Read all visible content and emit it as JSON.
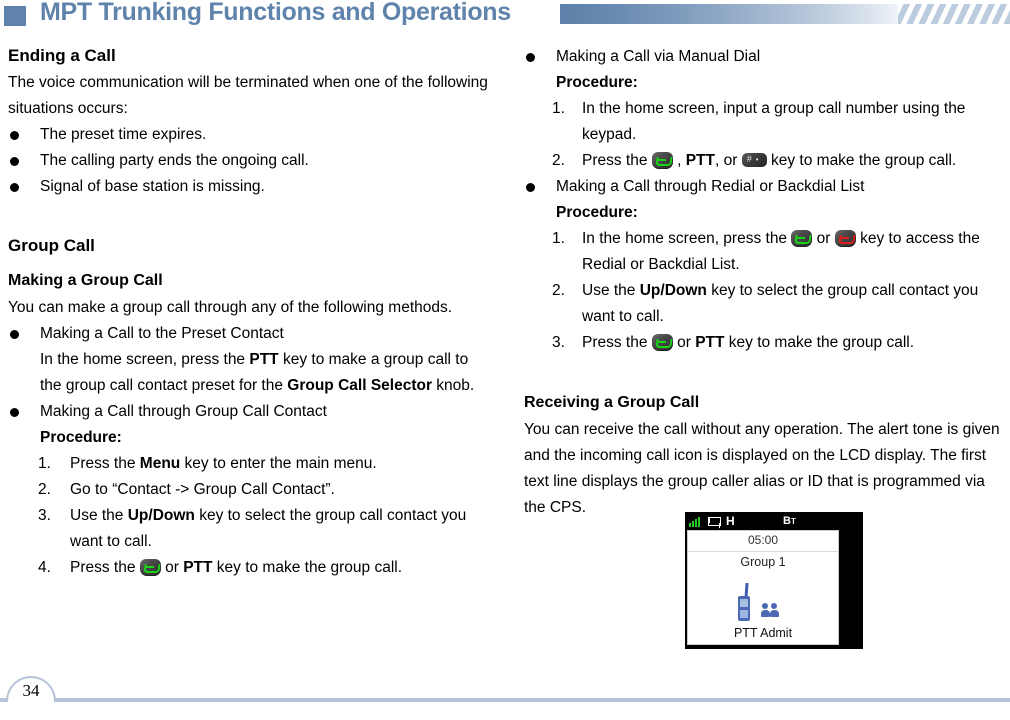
{
  "header": {
    "title": "MPT Trunking Functions and Operations",
    "accent_color": "#5f83ab"
  },
  "left_column": {
    "ending_a_call": {
      "heading": "Ending a Call",
      "intro": "The voice communication will be terminated when one of the following situations occurs:",
      "bullets": [
        "The preset time expires.",
        "The calling party ends the ongoing call.",
        "Signal of base station is missing."
      ]
    },
    "group_call": {
      "heading": "Group Call",
      "making_heading": "Making a Group Call",
      "intro": "You can make a group call through any of the following methods.",
      "preset_contact": {
        "title": "Making a Call to the Preset Contact",
        "body_1": "In the home screen, press the ",
        "body_ptt": "PTT",
        "body_2": " key to make a group call to the group call contact preset for the ",
        "body_bold_2": "Group Call Selector",
        "body_3": " knob."
      },
      "group_call_contact": {
        "title": "Making a Call through Group Call Contact",
        "procedure_label": "Procedure:",
        "steps": [
          {
            "num": "1.",
            "pre": "Press the ",
            "bold": "Menu",
            "post": " key to enter the main menu."
          },
          {
            "num": "2.",
            "pre": "Go to “Contact -> Group Call Contact”.",
            "bold": "",
            "post": ""
          },
          {
            "num": "3.",
            "pre": "Use the ",
            "bold": "Up/Down",
            "post": " key to select the group call contact you want to call."
          },
          {
            "num": "4.",
            "pre": "Press the ",
            "bold": "PTT",
            "post": " key to make the group call."
          }
        ],
        "step4_pre": "Press the ",
        "step4_mid": " or  ",
        "step4_bold": "PTT",
        "step4_post": " key to make the group call."
      }
    }
  },
  "right_column": {
    "manual_dial": {
      "title": "Making a Call via Manual Dial",
      "procedure_label": "Procedure:",
      "step1_num": "1.",
      "step1_text": "In the home screen, input a group call number using the keypad.",
      "step2_num": "2.",
      "step2_pre": "Press the ",
      "step2_mid": " , ",
      "step2_bold": "PTT",
      "step2_mid2": ", or ",
      "step2_post": " key to make the group call."
    },
    "redial": {
      "title": "Making a Call through Redial or Backdial List",
      "procedure_label": "Procedure:",
      "step1_num": "1.",
      "step1_pre": "In the home screen, press the ",
      "step1_mid": " or ",
      "step1_post": " key to access the Redial or Backdial List.",
      "step2_num": "2.",
      "step2_pre": "Use the ",
      "step2_bold": "Up/Down",
      "step2_post": " key to select the group call contact you want to call.",
      "step3_num": "3.",
      "step3_pre": "Press the ",
      "step3_mid": " or ",
      "step3_bold": "PTT",
      "step3_post": " key to make the group call."
    },
    "receiving": {
      "heading": "Receiving a Group Call",
      "body": "You can receive the call without any operation. The alert tone is given and the incoming call icon is displayed on the LCD display. The first text line displays the group caller alias or ID that is programmed via the CPS."
    }
  },
  "lcd": {
    "status_h": "H",
    "status_bt": "B",
    "status_bt_sub": "T",
    "time": "05:00",
    "group_name": "Group 1",
    "footer_text": "PTT Admit",
    "signal_color": "#22c722",
    "radio_color": "#4a68b4"
  },
  "footer": {
    "page_number": "34",
    "rule_color": "#b6c3d8"
  }
}
